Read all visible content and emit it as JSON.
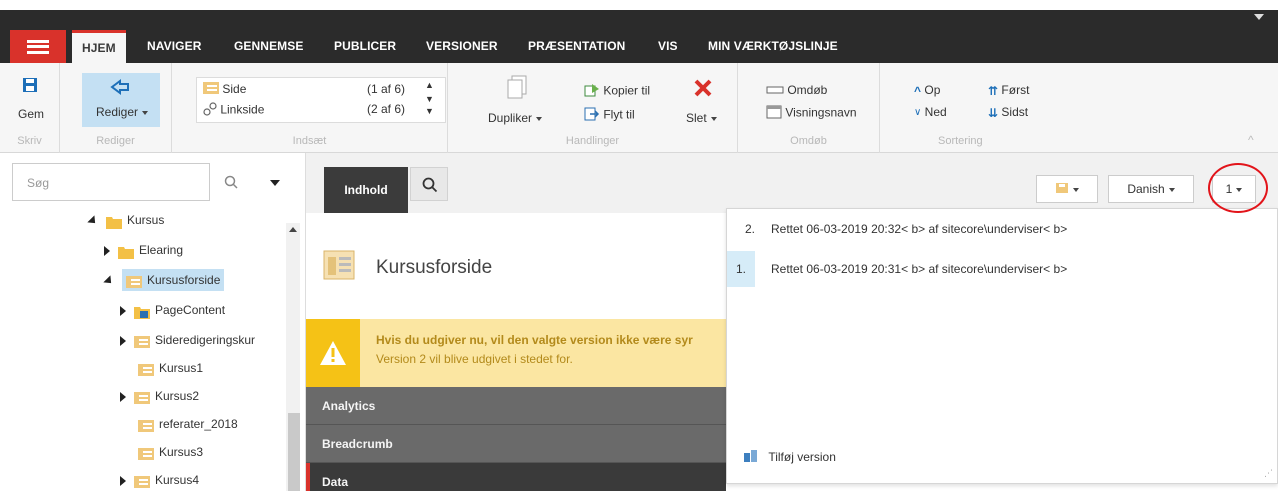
{
  "tabs": {
    "items": [
      "HJEM",
      "NAVIGER",
      "GENNEMSE",
      "PUBLICER",
      "VERSIONER",
      "PRÆSENTATION",
      "VIS",
      "MIN VÆRKTØJSLINJE"
    ],
    "active": "HJEM"
  },
  "ribbon": {
    "skriv": {
      "save_label": "Gem",
      "group_label": "Skriv"
    },
    "rediger": {
      "edit_label": "Rediger",
      "group_label": "Rediger"
    },
    "indsaet": {
      "group_label": "Indsæt",
      "items": [
        {
          "label": "Side",
          "count": "(1 af 6)"
        },
        {
          "label": "Linkside",
          "count": "(2 af 6)"
        }
      ]
    },
    "handlinger": {
      "group_label": "Handlinger",
      "duplicate_label": "Dupliker",
      "copy_label": "Kopier til",
      "move_label": "Flyt til",
      "delete_label": "Slet"
    },
    "omdob": {
      "group_label": "Omdøb",
      "rename_label": "Omdøb",
      "display_name_label": "Visningsnavn"
    },
    "sortering": {
      "group_label": "Sortering",
      "up_label": "Op",
      "down_label": "Ned",
      "first_label": "Først",
      "last_label": "Sidst"
    }
  },
  "search": {
    "placeholder": "Søg"
  },
  "tree": {
    "items": [
      {
        "label": "Kursus"
      },
      {
        "label": "Elearing"
      },
      {
        "label": "Kursusforside"
      },
      {
        "label": "PageContent"
      },
      {
        "label": "Sideredigeringskur"
      },
      {
        "label": "Kursus1"
      },
      {
        "label": "Kursus2"
      },
      {
        "label": "referater_2018"
      },
      {
        "label": "Kursus3"
      },
      {
        "label": "Kursus4"
      }
    ]
  },
  "editor": {
    "content_tab": "Indhold",
    "language": "Danish",
    "version_selector": "1",
    "item_title": "Kursusforside",
    "warning_line1": "Hvis du udgiver nu, vil den valgte version ikke være syr",
    "warning_line2": "Version 2 vil blive udgivet i stedet for.",
    "sections": [
      "Analytics",
      "Breadcrumb",
      "Data"
    ]
  },
  "versions": {
    "items": [
      {
        "number": "2.",
        "text": "Rettet 06-03-2019 20:32< b> af sitecore\\underviser< b>"
      },
      {
        "number": "1.",
        "text": "Rettet 06-03-2019 20:31< b> af sitecore\\underviser< b>"
      }
    ],
    "add_label": "Tilføj version"
  },
  "colors": {
    "accent_red": "#d9322b",
    "highlight_circle": "#e2141a",
    "warning_bg": "#fbe6a2",
    "warning_icon": "#f5c216",
    "selection_blue": "#d6ecf8"
  }
}
